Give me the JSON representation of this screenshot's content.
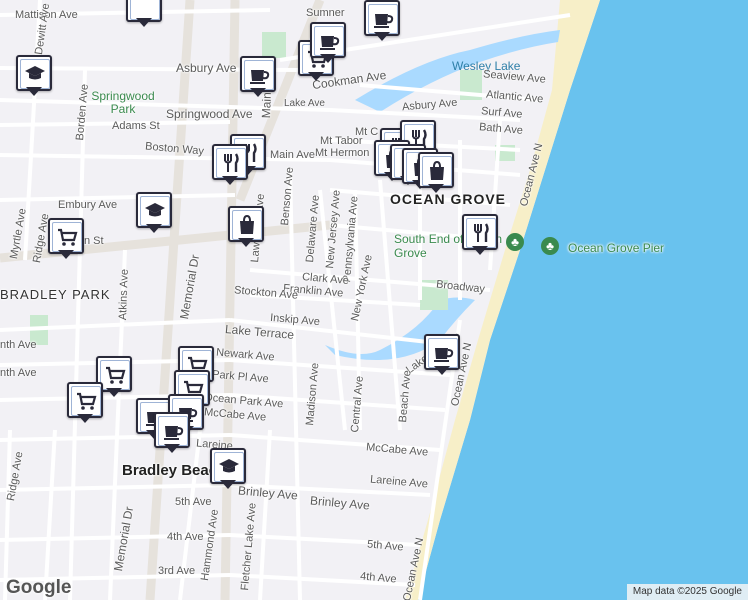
{
  "attribution": "Map data ©2025 Google",
  "logo": "Google",
  "colors": {
    "land": "#f2f1f5",
    "road": "#ffffff",
    "water": "#aadaff",
    "ocean": "#69c2ee",
    "park": "#c9e9cf",
    "sand": "#f7efc8",
    "arterial": "#e6e2dc"
  },
  "place_labels": {
    "ocean_grove": "OCEAN GROVE",
    "bradley_park": "BRADLEY PARK",
    "bradley_beach": "Bradley Beach",
    "springwood_park": "Springwood Park",
    "south_end": "South End of Ocean Grove",
    "pier": "Ocean Grove Pier",
    "wesley_lake": "Wesley Lake"
  },
  "street_labels": {
    "mattison": "Mattison Ave",
    "dewitt": "Dewitt Ave",
    "asbury_w": "Asbury Ave",
    "cookman": "Cookman Ave",
    "springwood": "Springwood Ave",
    "lake_ave": "Lake Ave",
    "adams": "Adams St",
    "borden": "Borden Ave",
    "boston": "Boston Way",
    "main_ave": "Main Ave",
    "mt_hermon": "Mt Hermon",
    "mt_tabor": "Mt Tabor",
    "mt_c": "Mt C",
    "asbury_e": "Asbury Ave",
    "seaview": "Seaview Ave",
    "atlantic": "Atlantic Ave",
    "surf": "Surf Ave",
    "bath": "Bath Ave",
    "embury": "Embury Ave",
    "ridge_top": "Ridge Ave",
    "myrtle": "Myrtle Ave",
    "n_st": "n St",
    "memorial": "Memorial Dr",
    "main_st": "Main St",
    "benson": "Benson Ave",
    "delaware": "Delaware Ave",
    "new_jersey": "New Jersey Ave",
    "pennsylvania": "Pennsylvania Ave",
    "new_york": "New York Ave",
    "lawrence": "Lawrence Ave",
    "clark": "Clark Ave",
    "franklin": "Franklin Ave",
    "stockton": "Stockton Ave",
    "inskip": "Inskip Ave",
    "broadway": "Broadway",
    "lake_terrace_w": "Lake Terrace",
    "lake_terrace_e": "Lake Terrace",
    "newark": "Newark Ave",
    "park_pl": "Park Pl Ave",
    "atkins": "Atkins Ave",
    "ocean_park": "Ocean Park Ave",
    "mccabe_w": "McCabe Ave",
    "mccabe_e": "McCabe Ave",
    "lareine_w": "Lareine",
    "lareine_e": "Lareine Ave",
    "madison": "Madison Ave",
    "central": "Central Ave",
    "beach_ave": "Beach Ave",
    "ocean_ave_n": "Ocean Ave N",
    "ocean_ave_n2": "Ocean Ave N",
    "ocean_ave_n3": "Ocean Ave N",
    "ridge_bottom": "Ridge Ave",
    "memorial_bottom": "Memorial Dr",
    "brinley_w": "Brinley Ave",
    "brinley_e": "Brinley Ave",
    "fifth_w": "5th Ave",
    "fifth_e": "5th Ave",
    "fourth_w": "4th Ave",
    "fourth_e": "4th Ave",
    "third": "3rd Ave",
    "hammond": "Hammond Ave",
    "fletcher": "Fletcher Lake Ave",
    "fifth_row_w": "5th Ave",
    "nth": "nth Ave",
    "nth2": "nth Ave",
    "sumner": "Sumner"
  }
}
